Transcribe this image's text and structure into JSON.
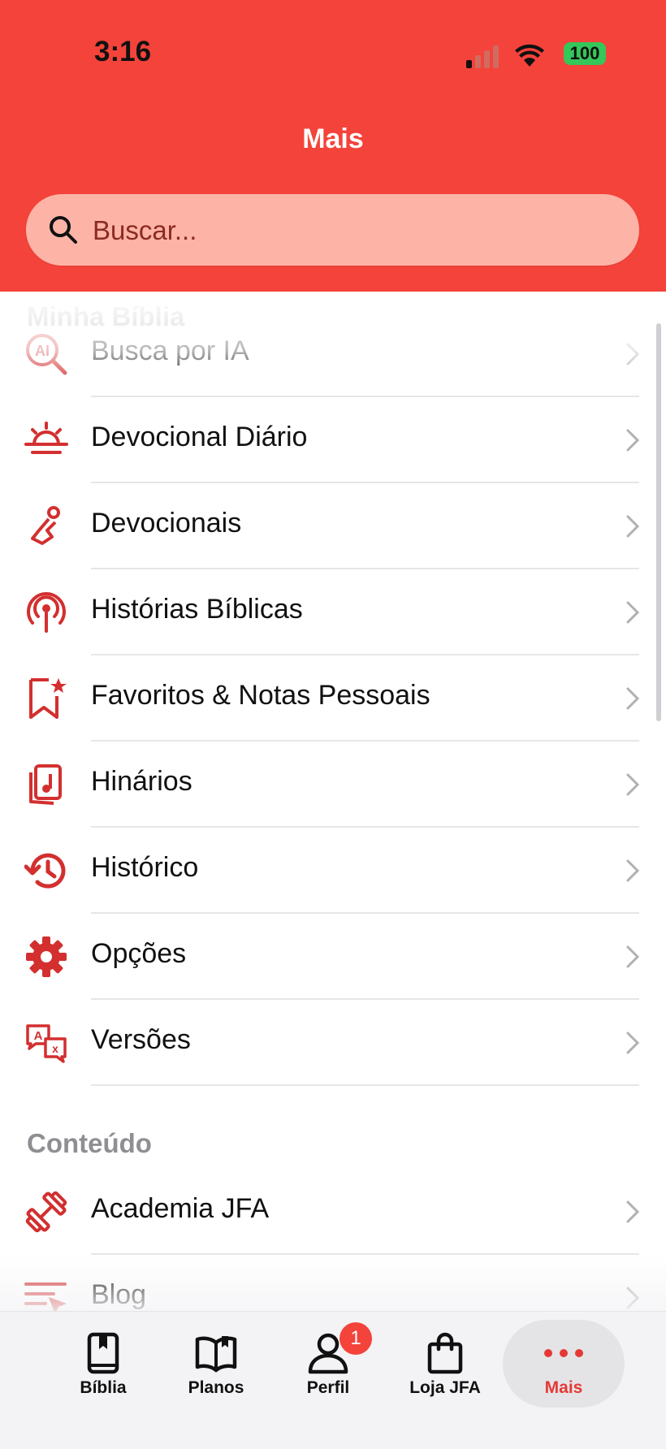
{
  "status_bar": {
    "time": "3:16",
    "battery": "100"
  },
  "header": {
    "title": "Mais"
  },
  "search": {
    "placeholder": "Buscar..."
  },
  "sections": [
    {
      "title": "Minha Bíblia",
      "items": [
        {
          "label": "Busca por IA",
          "icon": "ai-search-icon"
        },
        {
          "label": "Devocional Diário",
          "icon": "sunrise-icon"
        },
        {
          "label": "Devocionais",
          "icon": "praying-person-icon"
        },
        {
          "label": "Histórias Bíblicas",
          "icon": "podcast-icon"
        },
        {
          "label": "Favoritos & Notas Pessoais",
          "icon": "bookmark-star-icon"
        },
        {
          "label": "Hinários",
          "icon": "music-note-icon"
        },
        {
          "label": "Histórico",
          "icon": "history-icon"
        },
        {
          "label": "Opções",
          "icon": "gear-icon"
        },
        {
          "label": "Versões",
          "icon": "translate-icon"
        }
      ]
    },
    {
      "title": "Conteúdo",
      "items": [
        {
          "label": "Academia JFA",
          "icon": "dumbbell-icon"
        },
        {
          "label": "Blog",
          "icon": "blog-icon"
        }
      ]
    }
  ],
  "tabbar": {
    "items": [
      {
        "label": "Bíblia",
        "icon": "bible-icon"
      },
      {
        "label": "Planos",
        "icon": "open-book-icon"
      },
      {
        "label": "Perfil",
        "icon": "person-icon",
        "badge": "1"
      },
      {
        "label": "Loja JFA",
        "icon": "shopping-bag-icon"
      },
      {
        "label": "Mais",
        "icon": "more-dots-icon",
        "active": true
      }
    ]
  },
  "colors": {
    "accent": "#f4433a",
    "icon_red": "#d32f2f",
    "section_gray": "#8e8e93"
  }
}
